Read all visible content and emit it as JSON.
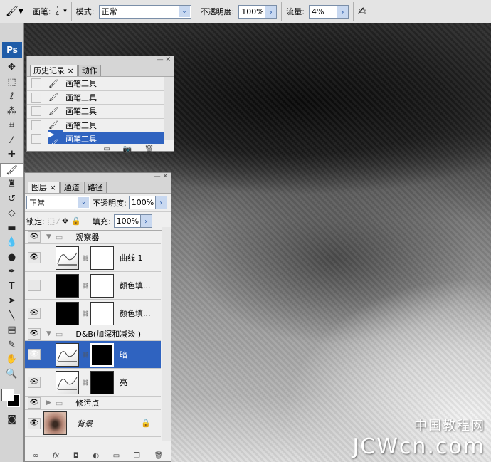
{
  "options_bar": {
    "brush_label": "画笔:",
    "brush_size": "4",
    "mode_label": "模式:",
    "mode_value": "正常",
    "opacity_label": "不透明度:",
    "opacity_value": "100%",
    "flow_label": "流量:",
    "flow_value": "4%"
  },
  "toolbox": {
    "logo": "Ps"
  },
  "history_panel": {
    "tabs": [
      "历史记录",
      "动作"
    ],
    "items": [
      "画笔工具",
      "画笔工具",
      "画笔工具",
      "画笔工具",
      "画笔工具"
    ],
    "selected_index": 4
  },
  "layers_panel": {
    "tabs": [
      "图层",
      "通道",
      "路径"
    ],
    "blend_mode": "正常",
    "opacity_label": "不透明度:",
    "opacity_value": "100%",
    "lock_label": "锁定:",
    "fill_label": "填充:",
    "fill_value": "100%",
    "layers": [
      {
        "name": "观察器",
        "type": "group",
        "expanded": true,
        "visible": true
      },
      {
        "name": "曲线 1",
        "type": "curves",
        "visible": true,
        "mask": "white"
      },
      {
        "name": "颜色填...",
        "type": "fill",
        "visible": false,
        "mask": "white"
      },
      {
        "name": "颜色填...",
        "type": "fill",
        "visible": true,
        "mask": "white"
      },
      {
        "name": "D&B(加深和减淡 )",
        "type": "group",
        "expanded": true,
        "visible": true
      },
      {
        "name": "暗",
        "type": "curves",
        "visible": true,
        "mask": "black",
        "selected": true
      },
      {
        "name": "亮",
        "type": "curves",
        "visible": true,
        "mask": "black"
      },
      {
        "name": "修污点",
        "type": "group",
        "expanded": false,
        "visible": true
      },
      {
        "name": "背景",
        "type": "background",
        "visible": true,
        "locked": true
      }
    ]
  },
  "watermark": {
    "line1": "中国教程网",
    "line2": "JCWcn.com"
  },
  "colors": {
    "selection": "#2f63c0",
    "panel_bg": "#efefef"
  }
}
